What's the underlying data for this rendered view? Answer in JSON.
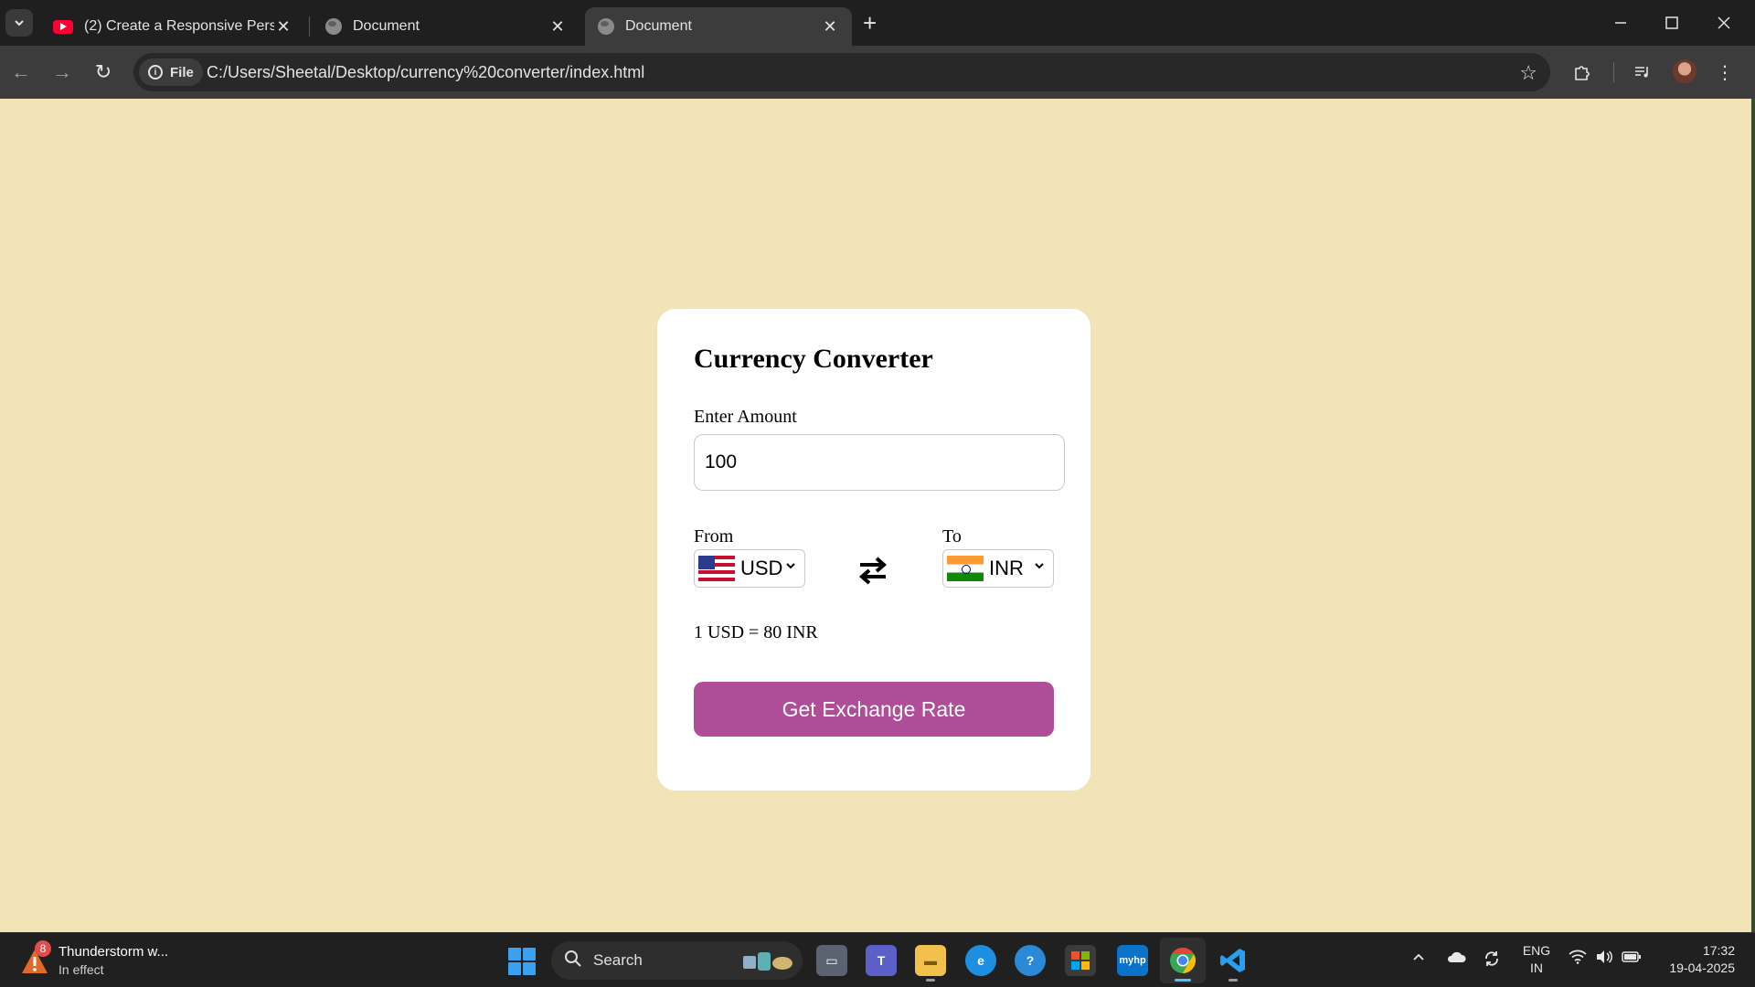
{
  "browser": {
    "tabs": [
      {
        "title": "(2) Create a Responsive Persona",
        "icon": "youtube-icon",
        "active": false
      },
      {
        "title": "Document",
        "icon": "globe-icon",
        "active": false
      },
      {
        "title": "Document",
        "icon": "globe-icon",
        "active": true
      }
    ],
    "address_chip": "File",
    "url": "C:/Users/Sheetal/Desktop/currency%20converter/index.html"
  },
  "app": {
    "title": "Currency Converter",
    "amount_label": "Enter Amount",
    "amount_value": "100",
    "from_label": "From",
    "to_label": "To",
    "from_currency": {
      "code": "USD",
      "flag": "us-flag"
    },
    "to_currency": {
      "code": "INR",
      "flag": "in-flag"
    },
    "rate_message": "1 USD = 80 INR",
    "button_label": "Get Exchange Rate",
    "colors": {
      "page_bg": "#f3e4b8",
      "card_bg": "#ffffff",
      "button_bg": "#af4d98"
    }
  },
  "taskbar": {
    "weather": {
      "badge": "8",
      "title": "Thunderstorm w...",
      "subtitle": "In effect"
    },
    "search_label": "Search",
    "language": {
      "line1": "ENG",
      "line2": "IN"
    },
    "clock": {
      "time": "17:32",
      "date": "19-04-2025"
    },
    "apps": [
      "file-explorer-icon",
      "teams-icon",
      "folder-icon",
      "edge-icon",
      "help-icon",
      "store-icon",
      "myhp-icon",
      "chrome-icon",
      "vscode-icon"
    ]
  }
}
